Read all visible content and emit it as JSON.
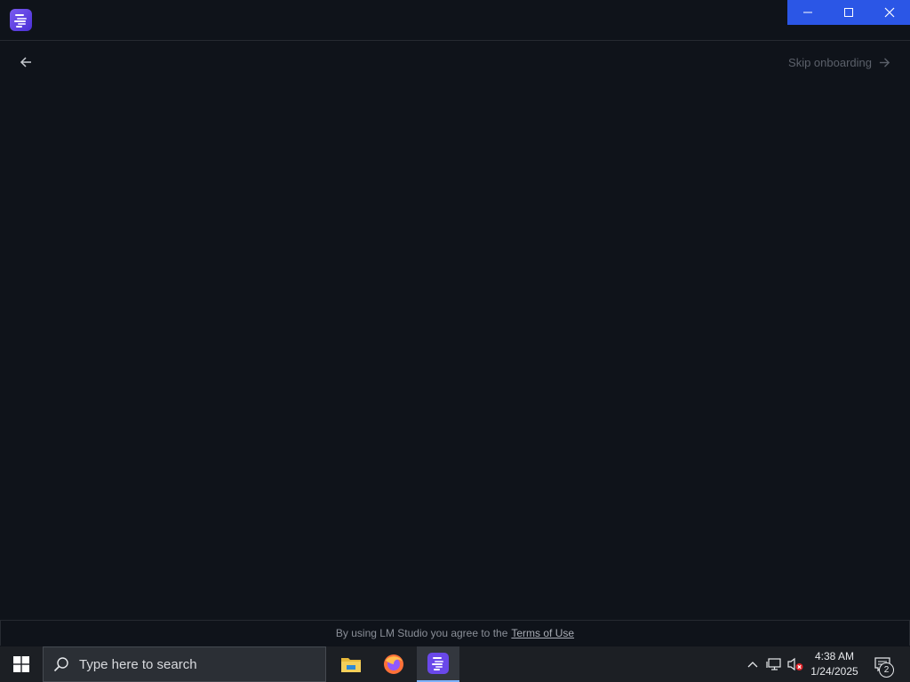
{
  "app": {
    "icon": "lm-studio-logo-icon"
  },
  "window_controls": {
    "minimize_icon": "minimize-icon",
    "maximize_icon": "maximize-icon",
    "close_icon": "close-icon",
    "accent_color": "#2b56e6"
  },
  "nav": {
    "back_icon": "arrow-left-icon",
    "skip_label": "Skip onboarding",
    "skip_icon": "arrow-right-icon"
  },
  "footer": {
    "text": "By using LM Studio you agree to the",
    "link_label": "Terms of Use"
  },
  "taskbar": {
    "search_placeholder": "Type here to search",
    "apps": [
      "file-explorer-icon",
      "firefox-icon",
      "lm-studio-icon"
    ],
    "clock_time": "4:38 AM",
    "clock_date": "1/24/2025",
    "notification_count": "2"
  }
}
